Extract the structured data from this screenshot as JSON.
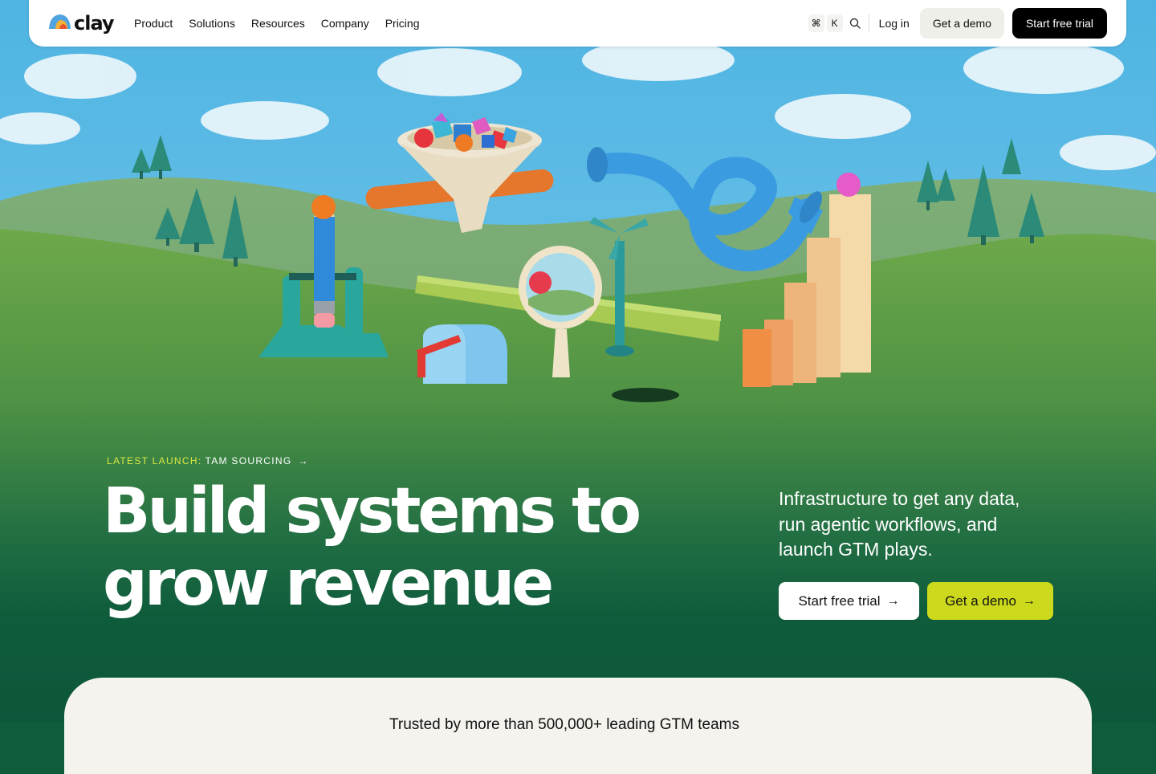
{
  "nav": {
    "logo_text": "clay",
    "links": [
      "Product",
      "Solutions",
      "Resources",
      "Company",
      "Pricing"
    ],
    "shortcut_keys": [
      "⌘",
      "K"
    ],
    "login_label": "Log in",
    "demo_label": "Get a demo",
    "trial_label": "Start free trial"
  },
  "hero": {
    "launch_label": "LATEST LAUNCH:",
    "launch_title": "TAM SOURCING",
    "launch_arrow": "→",
    "headline_line1": "Build systems to",
    "headline_line2": "grow revenue",
    "subtext": "Infrastructure to get any data, run agentic workflows, and launch GTM plays.",
    "cta_trial_label": "Start free trial",
    "cta_demo_label": "Get a demo",
    "cta_arrow": "→"
  },
  "trust": {
    "text": "Trusted by more than 500,000+ leading GTM teams"
  },
  "colors": {
    "accent_lime": "#ccd91c",
    "launch_label": "#dce842",
    "hero_green": "#0f5c3c",
    "trust_bg": "#f4f3ee"
  },
  "icons": [
    "search-icon",
    "arrow-right-icon",
    "clay-logo-icon"
  ]
}
